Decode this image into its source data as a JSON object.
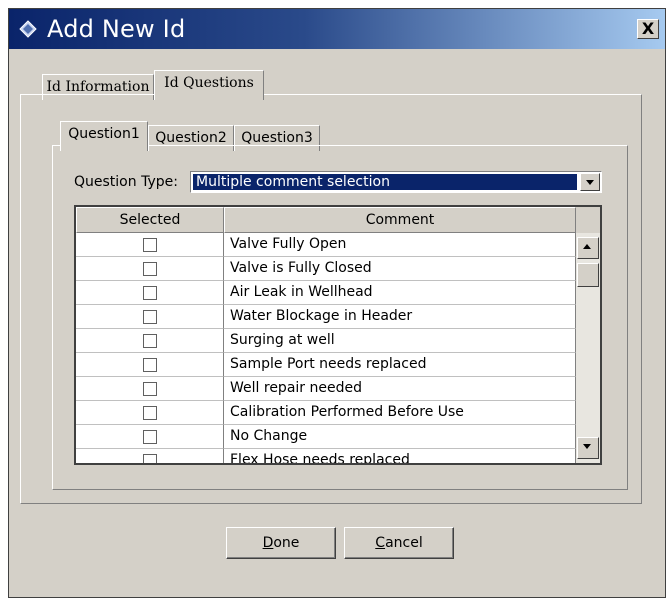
{
  "window": {
    "title": "Add New Id",
    "close_label": "X"
  },
  "outer_tabs": [
    {
      "label": "Id Information",
      "active": false
    },
    {
      "label": "Id Questions",
      "active": true
    }
  ],
  "inner_tabs": [
    {
      "label": "Question1",
      "active": true
    },
    {
      "label": "Question2",
      "active": false
    },
    {
      "label": "Question3",
      "active": false
    }
  ],
  "question_type": {
    "label": "Question Type:",
    "value": "Multiple comment selection"
  },
  "grid": {
    "columns": [
      "Selected",
      "Comment"
    ],
    "rows": [
      {
        "selected": false,
        "comment": "Valve Fully Open"
      },
      {
        "selected": false,
        "comment": "Valve is Fully Closed"
      },
      {
        "selected": false,
        "comment": "Air Leak in Wellhead"
      },
      {
        "selected": false,
        "comment": "Water Blockage in Header"
      },
      {
        "selected": false,
        "comment": "Surging at well"
      },
      {
        "selected": false,
        "comment": "Sample Port needs replaced"
      },
      {
        "selected": false,
        "comment": "Well repair needed"
      },
      {
        "selected": false,
        "comment": "Calibration Performed Before Use"
      },
      {
        "selected": false,
        "comment": "No Change"
      },
      {
        "selected": false,
        "comment": "Flex Hose needs replaced"
      }
    ]
  },
  "buttons": {
    "done": {
      "mnemonic": "D",
      "rest": "one"
    },
    "cancel": {
      "mnemonic": "C",
      "rest": "ancel"
    }
  },
  "colors": {
    "title_start": "#0a246a",
    "title_end": "#a6caf0",
    "face": "#d4d0c8",
    "selection": "#0a246a"
  },
  "icons": {
    "title": "diamond-app-icon",
    "close": "close-icon",
    "dropdown": "chevron-down-icon"
  }
}
